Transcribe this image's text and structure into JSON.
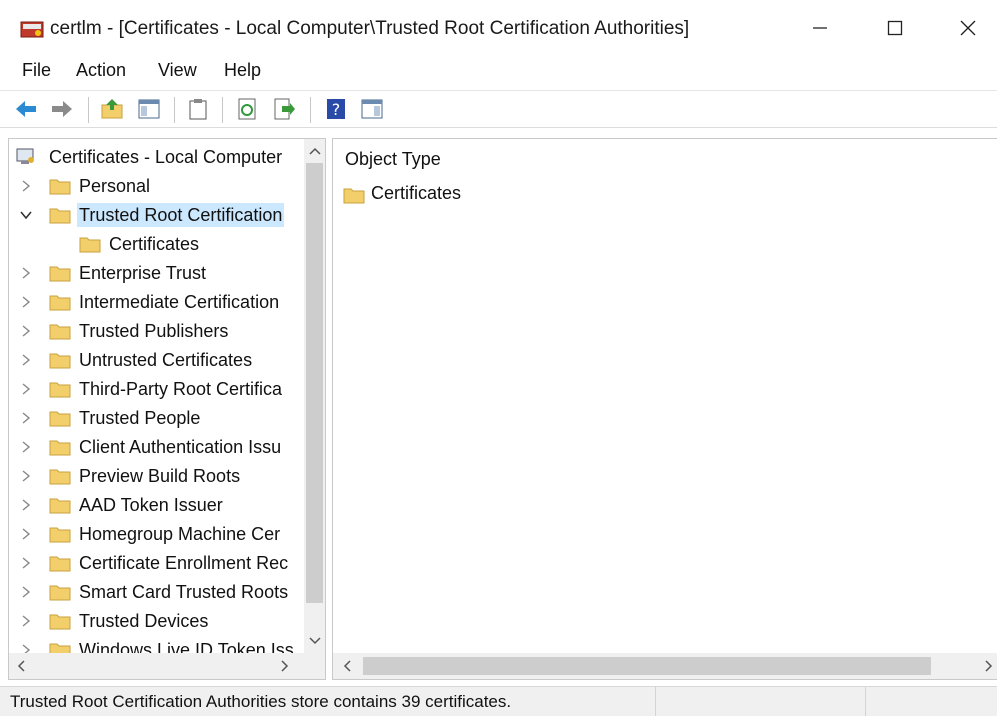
{
  "window": {
    "title": "certlm - [Certificates - Local Computer\\Trusted Root Certification Authorities]",
    "app_icon": "certificate-manager-icon",
    "controls": [
      "minimize-icon",
      "maximize-icon",
      "close-icon"
    ]
  },
  "menu": {
    "file": "File",
    "action": "Action",
    "view": "View",
    "help": "Help"
  },
  "toolbar": {
    "buttons": [
      "back-arrow-icon",
      "forward-arrow-icon",
      "up-folder-icon",
      "show-hide-console-tree-icon",
      "properties-clipboard-icon",
      "refresh-icon",
      "export-list-icon",
      "help-icon",
      "action-pane-icon"
    ]
  },
  "tree": {
    "root": "Certificates - Local Computer",
    "items": [
      {
        "label": "Personal",
        "expanded": false
      },
      {
        "label": "Trusted Root Certification",
        "expanded": true,
        "selected": true
      },
      {
        "label": "Certificates",
        "child": true
      },
      {
        "label": "Enterprise Trust",
        "expanded": false
      },
      {
        "label": "Intermediate Certification",
        "expanded": false
      },
      {
        "label": "Trusted Publishers",
        "expanded": false
      },
      {
        "label": "Untrusted Certificates",
        "expanded": false
      },
      {
        "label": "Third-Party Root Certifica",
        "expanded": false
      },
      {
        "label": "Trusted People",
        "expanded": false
      },
      {
        "label": "Client Authentication Issu",
        "expanded": false
      },
      {
        "label": "Preview Build Roots",
        "expanded": false
      },
      {
        "label": "AAD Token Issuer",
        "expanded": false
      },
      {
        "label": "Homegroup Machine Cer",
        "expanded": false
      },
      {
        "label": "Certificate Enrollment Rec",
        "expanded": false
      },
      {
        "label": "Smart Card Trusted Roots",
        "expanded": false
      },
      {
        "label": "Trusted Devices",
        "expanded": false
      },
      {
        "label": "Windows Live ID Token Iss",
        "expanded": false
      }
    ]
  },
  "details": {
    "column_header": "Object Type",
    "items": [
      "Certificates"
    ]
  },
  "status": {
    "text": "Trusted Root Certification Authorities store contains 39 certificates."
  },
  "colors": {
    "selection": "#cce8ff",
    "folder": "#f2cf6b",
    "scrollbar_track": "#f0f0f0",
    "scrollbar_thumb": "#cdcdcd"
  }
}
